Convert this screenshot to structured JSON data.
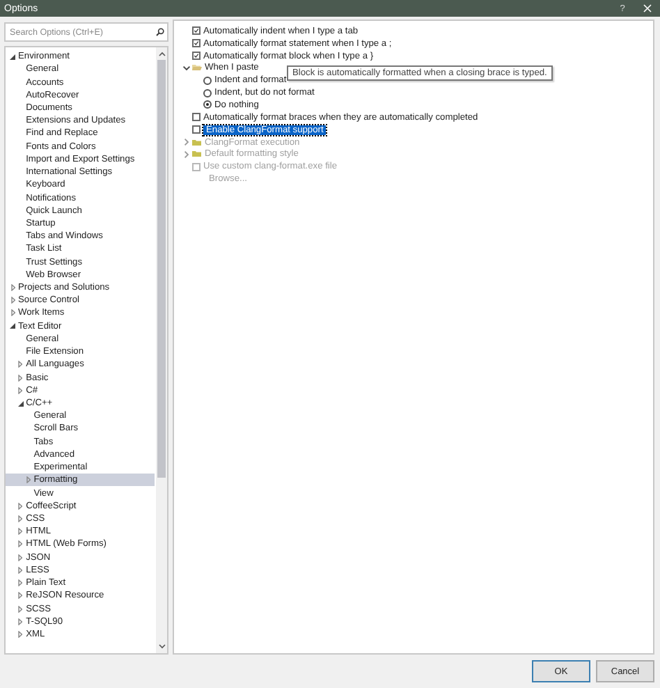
{
  "window": {
    "title": "Options",
    "help": "?"
  },
  "search": {
    "placeholder": "Search Options (Ctrl+E)"
  },
  "tree": [
    {
      "label": "Environment",
      "expanded": true,
      "selected": false,
      "children": [
        {
          "label": "General",
          "selected": false
        },
        {
          "label": "Accounts",
          "selected": false
        },
        {
          "label": "AutoRecover",
          "selected": false
        },
        {
          "label": "Documents",
          "selected": false
        },
        {
          "label": "Extensions and Updates",
          "selected": false
        },
        {
          "label": "Find and Replace",
          "selected": false
        },
        {
          "label": "Fonts and Colors",
          "selected": false
        },
        {
          "label": "Import and Export Settings",
          "selected": false
        },
        {
          "label": "International Settings",
          "selected": false
        },
        {
          "label": "Keyboard",
          "selected": false
        },
        {
          "label": "Notifications",
          "selected": false
        },
        {
          "label": "Quick Launch",
          "selected": false
        },
        {
          "label": "Startup",
          "selected": false
        },
        {
          "label": "Tabs and Windows",
          "selected": false
        },
        {
          "label": "Task List",
          "selected": false
        },
        {
          "label": "Trust Settings",
          "selected": false
        },
        {
          "label": "Web Browser",
          "selected": false
        }
      ]
    },
    {
      "label": "Projects and Solutions",
      "expanded": false,
      "selected": false
    },
    {
      "label": "Source Control",
      "expanded": false,
      "selected": false
    },
    {
      "label": "Work Items",
      "expanded": false,
      "selected": false
    },
    {
      "label": "Text Editor",
      "expanded": true,
      "selected": false,
      "children": [
        {
          "label": "General",
          "selected": false
        },
        {
          "label": "File Extension",
          "selected": false
        },
        {
          "label": "All Languages",
          "expanded": false,
          "selected": false
        },
        {
          "label": "Basic",
          "expanded": false,
          "selected": false
        },
        {
          "label": "C#",
          "expanded": false,
          "selected": false
        },
        {
          "label": "C/C++",
          "expanded": true,
          "selected": false,
          "children": [
            {
              "label": "General",
              "selected": false
            },
            {
              "label": "Scroll Bars",
              "selected": false
            },
            {
              "label": "Tabs",
              "selected": false
            },
            {
              "label": "Advanced",
              "selected": false
            },
            {
              "label": "Experimental",
              "selected": false
            },
            {
              "label": "Formatting",
              "expanded": false,
              "selected": true
            },
            {
              "label": "View",
              "selected": false
            }
          ]
        },
        {
          "label": "CoffeeScript",
          "expanded": false,
          "selected": false
        },
        {
          "label": "CSS",
          "expanded": false,
          "selected": false
        },
        {
          "label": "HTML",
          "expanded": false,
          "selected": false
        },
        {
          "label": "HTML (Web Forms)",
          "expanded": false,
          "selected": false
        },
        {
          "label": "JSON",
          "expanded": false,
          "selected": false
        },
        {
          "label": "LESS",
          "expanded": false,
          "selected": false
        },
        {
          "label": "Plain Text",
          "expanded": false,
          "selected": false
        },
        {
          "label": "ReJSON Resource",
          "expanded": false,
          "selected": false
        },
        {
          "label": "SCSS",
          "expanded": false,
          "selected": false
        },
        {
          "label": "T-SQL90",
          "expanded": false,
          "selected": false
        },
        {
          "label": "XML",
          "expanded": false,
          "selected": false
        }
      ]
    }
  ],
  "options": [
    {
      "kind": "checkbox",
      "label": "Automatically indent when I type a tab",
      "checked": true,
      "disabled": false,
      "highlighted": false
    },
    {
      "kind": "checkbox",
      "label": "Automatically format statement when I type a ;",
      "checked": true,
      "disabled": false,
      "highlighted": false
    },
    {
      "kind": "checkbox",
      "label": "Automatically format block when I type a }",
      "checked": true,
      "disabled": false,
      "highlighted": false
    },
    {
      "kind": "group",
      "label": "When I paste",
      "expanded": true,
      "disabled": false,
      "children": [
        {
          "kind": "radio",
          "label": "Indent and format",
          "selected": false
        },
        {
          "kind": "radio",
          "label": "Indent, but do not format",
          "selected": false
        },
        {
          "kind": "radio",
          "label": "Do nothing",
          "selected": true
        }
      ]
    },
    {
      "kind": "checkbox",
      "label": "Automatically format braces when they are automatically completed",
      "checked": false,
      "disabled": false,
      "highlighted": false
    },
    {
      "kind": "checkbox",
      "label": "Enable ClangFormat support",
      "checked": false,
      "disabled": false,
      "highlighted": true
    },
    {
      "kind": "group",
      "label": "ClangFormat execution",
      "expanded": false,
      "disabled": true
    },
    {
      "kind": "group",
      "label": "Default formatting style",
      "expanded": false,
      "disabled": true
    },
    {
      "kind": "checkbox",
      "label": "Use custom clang-format.exe file",
      "checked": false,
      "disabled": true,
      "highlighted": false
    },
    {
      "kind": "button",
      "label": "Browse...",
      "disabled": true
    }
  ],
  "tooltip": "Block is automatically formatted when a closing brace is typed.",
  "buttons": [
    {
      "label": "OK",
      "default": true
    },
    {
      "label": "Cancel",
      "default": false
    }
  ]
}
